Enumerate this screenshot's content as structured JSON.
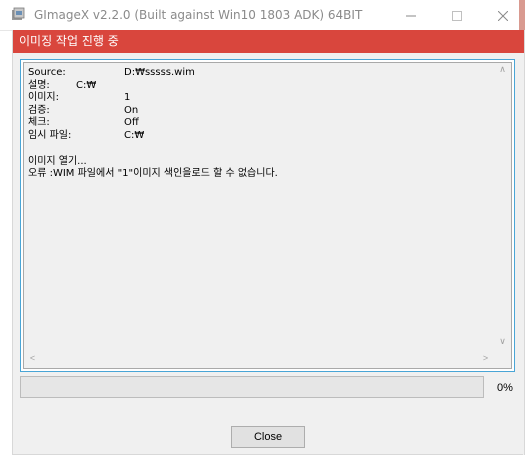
{
  "window": {
    "title": "GImageX v2.2.0 (Built against Win10 1803 ADK) 64BIT",
    "minimize_icon": "minimize-icon",
    "maximize_icon": "maximize-icon",
    "close_icon": "close-icon"
  },
  "dialog": {
    "header": "이미징 작업 진행 중",
    "header_color": "#d9463d",
    "log": {
      "fields": [
        {
          "label": "Source:",
          "value": "D:₩sssss.wim"
        },
        {
          "label": "설명:",
          "value": "C:₩"
        },
        {
          "label": "이미지:",
          "value": "1"
        },
        {
          "label": "검증:",
          "value": "On"
        },
        {
          "label": "체크:",
          "value": "Off"
        },
        {
          "label": "임시 파일:",
          "value": "C:₩"
        }
      ],
      "messages": [
        "이미지 열기...",
        "오류 :WIM 파일에서 \"1\"이미지 색인을로드 할 수 없습니다."
      ]
    },
    "progress": {
      "percent_label": "0%",
      "value": 0
    },
    "close_label": "Close"
  }
}
